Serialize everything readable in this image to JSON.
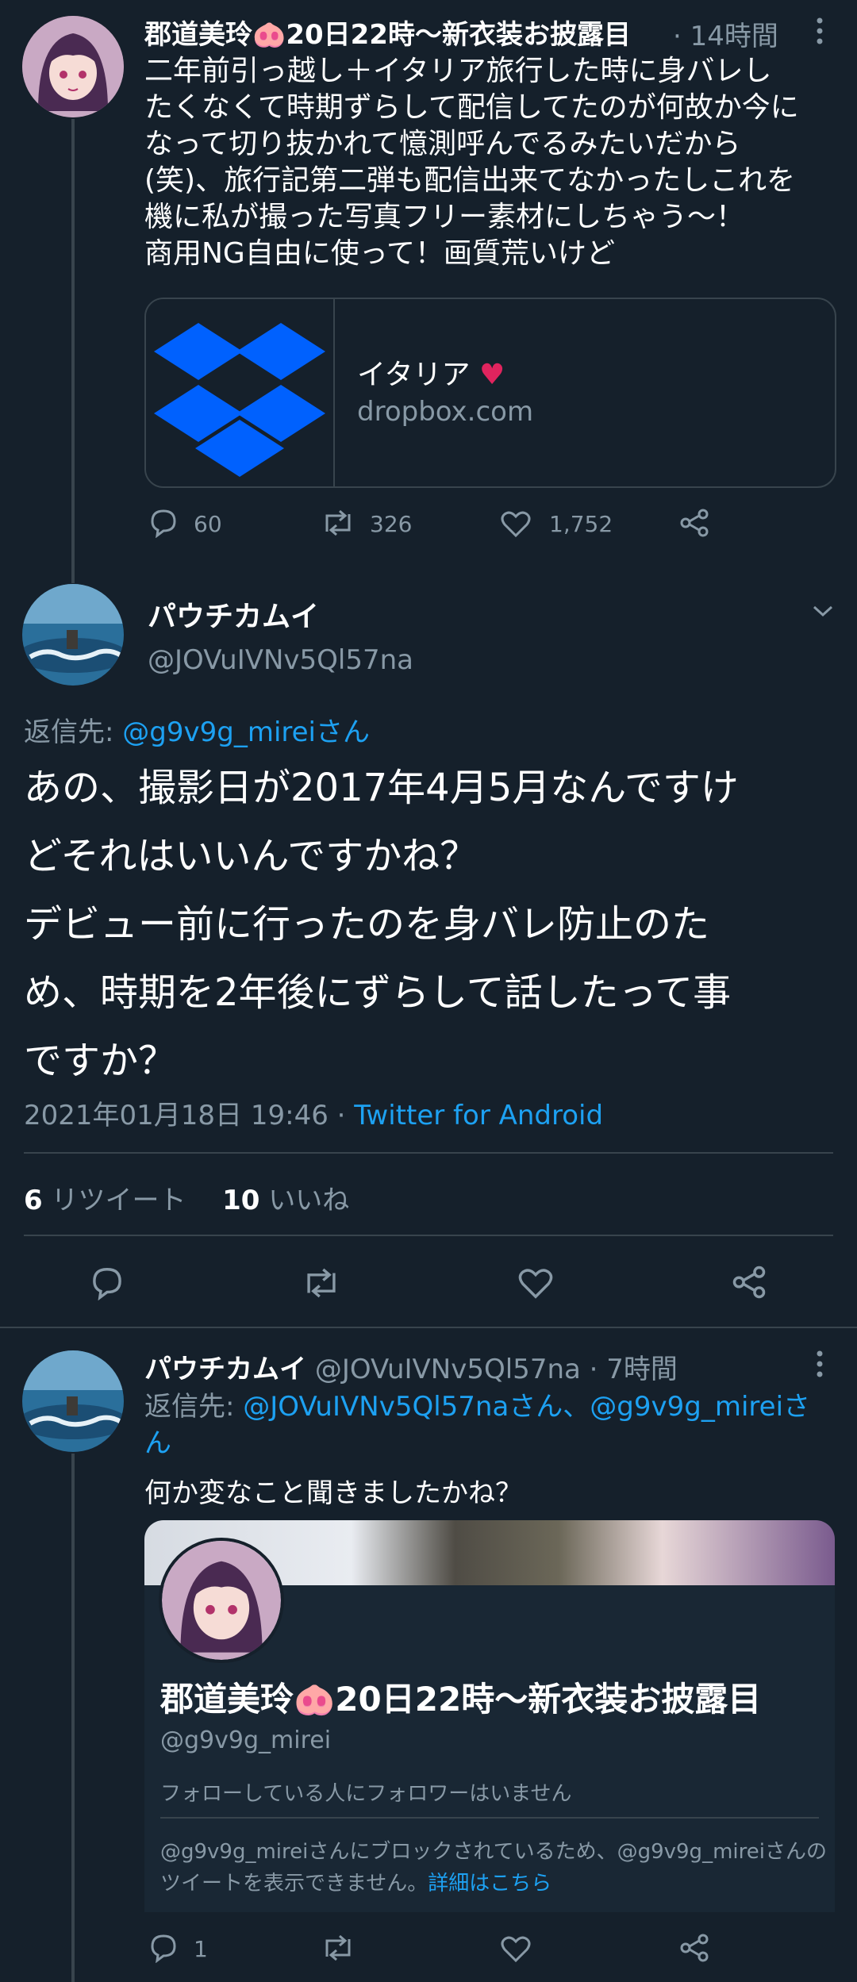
{
  "tweet1": {
    "name": "郡道美玲🐽20日22時〜新衣装お披露目",
    "time": "· 14時間",
    "lines": [
      "二年前引っ越し＋イタリア旅行した時に身バレし",
      "たくなくて時期ずらして配信してたのが何故か今に",
      "なって切り抜かれて憶測呼んでるみたいだから",
      "(笑)、旅行記第二弾も配信出来てなかったしこれを",
      "機に私が撮った写真フリー素材にしちゃう〜！",
      "商用NG自由に使って！画質荒いけど"
    ],
    "card_title": "イタリア",
    "card_domain": "dropbox.com",
    "replies": "60",
    "retweets": "326",
    "likes": "1,752"
  },
  "main": {
    "name": "パウチカムイ",
    "handle": "@JOVuIVNv5Ql57na",
    "reply_prefix": "返信先:",
    "reply_to": "@g9v9g_mireiさん",
    "lines": [
      "あの、撮影日が2017年4月5月なんですけ",
      "どそれはいいんですかね？",
      "デビュー前に行ったのを身バレ防止のた",
      "め、時期を2年後にずらして話したって事",
      "ですか？"
    ],
    "timestamp": "2021年01月18日 19:46 · ",
    "client": "Twitter for Android",
    "retweet_count": "6",
    "retweet_label": "リツイート",
    "like_count": "10",
    "like_label": "いいね"
  },
  "tweet3": {
    "name": "パウチカムイ",
    "handle_time": "@JOVuIVNv5Ql57na · 7時間",
    "reply_prefix": "返信先:",
    "reply_to_line1": "@JOVuIVNv5Ql57naさん、@g9v9g_mireiさ",
    "reply_to_line2": "ん",
    "text": "何か変なこと聞きましたかね？",
    "quoted": {
      "name": "郡道美玲🐽20日22時〜新衣装お披露目",
      "handle": "@g9v9g_mirei",
      "followers_note": "フォローしている人にフォロワーはいません",
      "blocked_line1": "@g9v9g_mireiさんにブロックされているため、@g9v9g_mireiさんの",
      "blocked_line2": "ツイートを表示できません。",
      "details_link": "詳細はこちら"
    },
    "replies": "1"
  },
  "colors": {
    "background": "#15202b",
    "accent": "#1da1f2",
    "muted": "#8899a6",
    "border": "#38444d",
    "heart": "#e0245e",
    "dropbox": "#0061fe"
  }
}
